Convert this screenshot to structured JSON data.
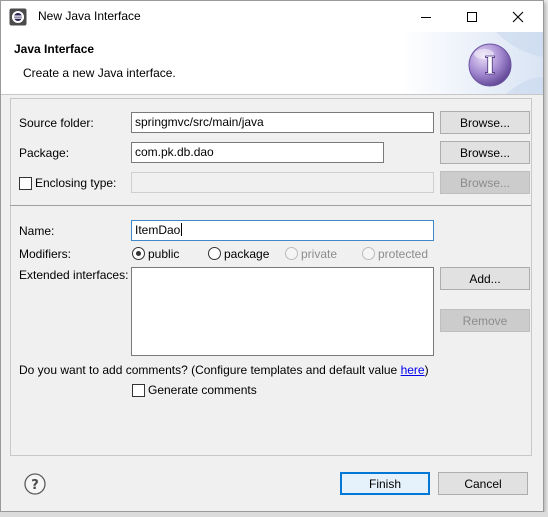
{
  "window": {
    "title": "New Java Interface"
  },
  "banner": {
    "title": "Java Interface",
    "description": "Create a new Java interface."
  },
  "form": {
    "source_folder": {
      "label": "Source folder:",
      "value": "springmvc/src/main/java",
      "button": "Browse..."
    },
    "package": {
      "label": "Package:",
      "value": "com.pk.db.dao",
      "button": "Browse..."
    },
    "enclosing_type": {
      "label": "Enclosing type:",
      "value": "",
      "checked": false,
      "button": "Browse..."
    },
    "name": {
      "label": "Name:",
      "value": "ItemDao"
    },
    "modifiers": {
      "label": "Modifiers:",
      "options": [
        {
          "label": "public",
          "selected": true,
          "enabled": true
        },
        {
          "label": "package",
          "selected": false,
          "enabled": true
        },
        {
          "label": "private",
          "selected": false,
          "enabled": false
        },
        {
          "label": "protected",
          "selected": false,
          "enabled": false
        }
      ]
    },
    "extended_interfaces": {
      "label": "Extended interfaces:",
      "add_button": "Add...",
      "remove_button": "Remove",
      "items": []
    },
    "comments": {
      "question_prefix": "Do you want to add comments? (Configure templates and default value ",
      "link_text": "here",
      "question_suffix": ")",
      "generate_label": "Generate comments",
      "generate_checked": false
    }
  },
  "footer": {
    "finish_label": "Finish",
    "cancel_label": "Cancel"
  },
  "colors": {
    "banner_bg": "#ffffff",
    "dialog_bg": "#f0f0f0",
    "focus_border": "#3f89c9",
    "default_button_border": "#0078d7",
    "link": "#0000ee"
  }
}
